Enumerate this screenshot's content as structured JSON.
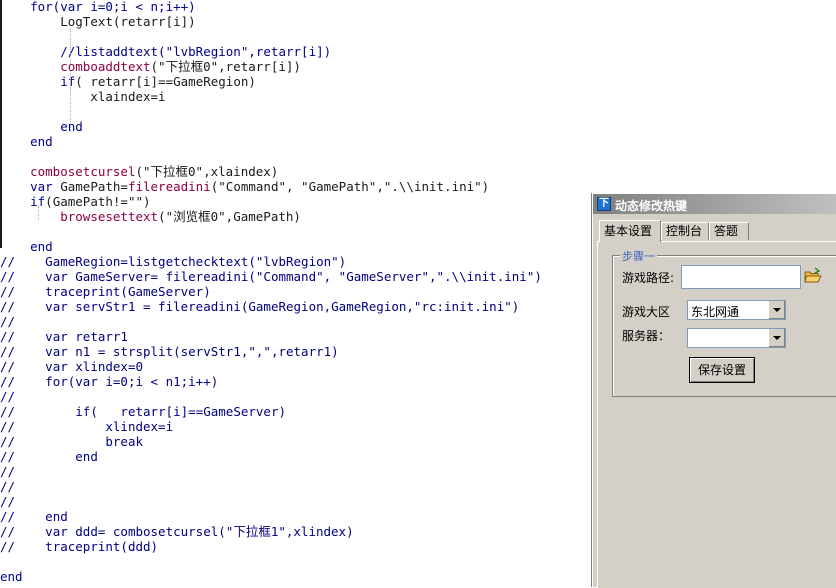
{
  "code_lines": [
    {
      "gutter": "",
      "indent": "    ",
      "segments": [
        {
          "t": "kw",
          "v": "for(var i=0;i < n;i++)"
        }
      ]
    },
    {
      "gutter": "",
      "indent": "        ",
      "segments": [
        {
          "t": "tx",
          "v": "LogText(retarr[i])"
        }
      ]
    },
    {
      "gutter": "",
      "indent": "",
      "segments": []
    },
    {
      "gutter": "",
      "indent": "        ",
      "segments": [
        {
          "t": "cm",
          "v": "//listaddtext(\"lvbRegion\",retarr[i])"
        }
      ]
    },
    {
      "gutter": "",
      "indent": "        ",
      "segments": [
        {
          "t": "fn",
          "v": "comboaddtext"
        },
        {
          "t": "tx",
          "v": "(\"下拉框0\",retarr[i])"
        }
      ]
    },
    {
      "gutter": "",
      "indent": "        ",
      "segments": [
        {
          "t": "kw",
          "v": "if"
        },
        {
          "t": "tx",
          "v": "( retarr[i]==GameRegion)"
        }
      ]
    },
    {
      "gutter": "",
      "indent": "            ",
      "segments": [
        {
          "t": "tx",
          "v": "xlaindex=i"
        }
      ]
    },
    {
      "gutter": "",
      "indent": "",
      "segments": []
    },
    {
      "gutter": "",
      "indent": "        ",
      "segments": [
        {
          "t": "kw",
          "v": "end"
        }
      ]
    },
    {
      "gutter": "",
      "indent": "    ",
      "segments": [
        {
          "t": "kw",
          "v": "end"
        }
      ]
    },
    {
      "gutter": "",
      "indent": "",
      "segments": []
    },
    {
      "gutter": "",
      "indent": "    ",
      "segments": [
        {
          "t": "fn",
          "v": "combosetcursel"
        },
        {
          "t": "tx",
          "v": "(\"下拉框0\",xlaindex)"
        }
      ]
    },
    {
      "gutter": "",
      "indent": "    ",
      "segments": [
        {
          "t": "kw",
          "v": "var"
        },
        {
          "t": "tx",
          "v": " GamePath="
        },
        {
          "t": "fn",
          "v": "filereadini"
        },
        {
          "t": "tx",
          "v": "(\"Command\", \"GamePath\",\".\\\\init.ini\")"
        }
      ]
    },
    {
      "gutter": "",
      "indent": "    ",
      "segments": [
        {
          "t": "kw",
          "v": "if"
        },
        {
          "t": "tx",
          "v": "(GamePath!=\"\")"
        }
      ]
    },
    {
      "gutter": "",
      "indent": "        ",
      "segments": [
        {
          "t": "fn",
          "v": "browsesettext"
        },
        {
          "t": "tx",
          "v": "(\"浏览框0\",GamePath)"
        }
      ]
    },
    {
      "gutter": "",
      "indent": "",
      "segments": []
    },
    {
      "gutter": "",
      "indent": "    ",
      "segments": [
        {
          "t": "kw",
          "v": "end"
        }
      ]
    },
    {
      "gutter": "//",
      "indent": "    ",
      "segments": [
        {
          "t": "cm",
          "v": "GameRegion=listgetchecktext(\"lvbRegion\")"
        }
      ]
    },
    {
      "gutter": "//",
      "indent": "    ",
      "segments": [
        {
          "t": "cm",
          "v": "var GameServer= filereadini(\"Command\", \"GameServer\",\".\\\\init.ini\")"
        }
      ]
    },
    {
      "gutter": "//",
      "indent": "    ",
      "segments": [
        {
          "t": "cm",
          "v": "traceprint(GameServer)"
        }
      ]
    },
    {
      "gutter": "//",
      "indent": "    ",
      "segments": [
        {
          "t": "cm",
          "v": "var servStr1 = filereadini(GameRegion,GameRegion,\"rc:init.ini\")"
        }
      ]
    },
    {
      "gutter": "//",
      "indent": "",
      "segments": []
    },
    {
      "gutter": "//",
      "indent": "    ",
      "segments": [
        {
          "t": "cm",
          "v": "var retarr1"
        }
      ]
    },
    {
      "gutter": "//",
      "indent": "    ",
      "segments": [
        {
          "t": "cm",
          "v": "var n1 = strsplit(servStr1,\",\",retarr1)"
        }
      ]
    },
    {
      "gutter": "//",
      "indent": "    ",
      "segments": [
        {
          "t": "cm",
          "v": "var xlindex=0"
        }
      ]
    },
    {
      "gutter": "//",
      "indent": "    ",
      "segments": [
        {
          "t": "cm",
          "v": "for(var i=0;i < n1;i++)"
        }
      ]
    },
    {
      "gutter": "//",
      "indent": "",
      "segments": []
    },
    {
      "gutter": "//",
      "indent": "        ",
      "segments": [
        {
          "t": "cm",
          "v": "if(   retarr[i]==GameServer)"
        }
      ]
    },
    {
      "gutter": "//",
      "indent": "            ",
      "segments": [
        {
          "t": "cm",
          "v": "xlindex=i"
        }
      ]
    },
    {
      "gutter": "//",
      "indent": "            ",
      "segments": [
        {
          "t": "cm",
          "v": "break"
        }
      ]
    },
    {
      "gutter": "//",
      "indent": "        ",
      "segments": [
        {
          "t": "cm",
          "v": "end"
        }
      ]
    },
    {
      "gutter": "//",
      "indent": "",
      "segments": []
    },
    {
      "gutter": "//",
      "indent": "",
      "segments": []
    },
    {
      "gutter": "//",
      "indent": "",
      "segments": []
    },
    {
      "gutter": "//",
      "indent": "    ",
      "segments": [
        {
          "t": "cm",
          "v": "end"
        }
      ]
    },
    {
      "gutter": "//",
      "indent": "    ",
      "segments": [
        {
          "t": "cm",
          "v": "var ddd= combosetcursel(\"下拉框1\",xlindex)"
        }
      ]
    },
    {
      "gutter": "//",
      "indent": "    ",
      "segments": [
        {
          "t": "cm",
          "v": "traceprint(ddd)"
        }
      ]
    },
    {
      "gutter": "",
      "indent": "",
      "segments": []
    },
    {
      "gutter": "",
      "indent": "",
      "segments": [
        {
          "t": "kw",
          "v": "end"
        }
      ]
    }
  ],
  "dialog": {
    "title": "动态修改热键",
    "app_icon_glyph": "下",
    "tabs": [
      {
        "label": "基本设置",
        "active": true
      },
      {
        "label": "控制台",
        "active": false
      },
      {
        "label": "答题",
        "active": false
      }
    ],
    "group_title": "步骤一",
    "game_path_label": "游戏路径:",
    "game_path_value": "",
    "region_label": "游戏大区",
    "region_selected": "东北网通",
    "server_label": "服务器：",
    "server_selected": "",
    "save_button": "保存设置"
  },
  "colors": {
    "keyword": "#00008b",
    "function": "#8b0045",
    "comment": "#000080",
    "dialog_bg": "#d4d0c8"
  },
  "icons": {
    "app": "app-logo-icon",
    "browse": "folder-open-icon",
    "combo_arrow": "chevron-down-icon"
  }
}
